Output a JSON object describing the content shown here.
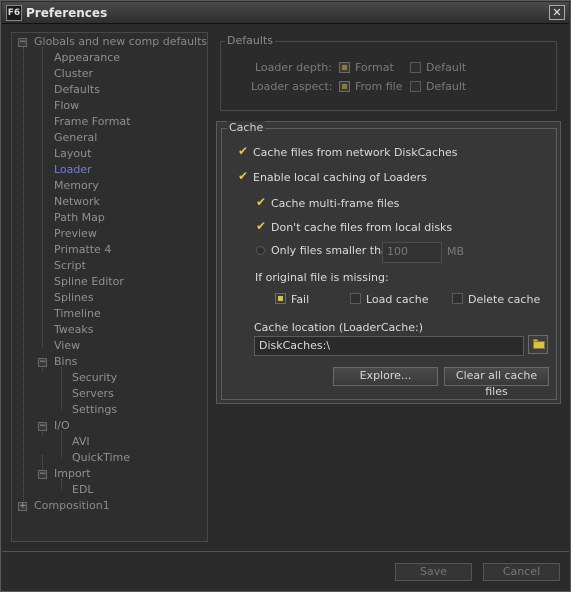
{
  "window": {
    "app_icon": "F6",
    "title": "Preferences",
    "close_glyph": "✕"
  },
  "tree": {
    "root": "Globals and new comp defaults",
    "items": [
      "Appearance",
      "Cluster",
      "Defaults",
      "Flow",
      "Frame Format",
      "General",
      "Layout",
      "Loader",
      "Memory",
      "Network",
      "Path Map",
      "Preview",
      "Primatte 4",
      "Script",
      "Spline Editor",
      "Splines",
      "Timeline",
      "Tweaks",
      "View"
    ],
    "selected": "Loader",
    "bins": {
      "label": "Bins",
      "children": [
        "Security",
        "Servers",
        "Settings"
      ]
    },
    "io": {
      "label": "I/O",
      "children": [
        "AVI",
        "QuickTime"
      ]
    },
    "import": {
      "label": "Import",
      "children": [
        "EDL"
      ]
    },
    "composition": "Composition1",
    "expander_minus": "−",
    "expander_plus": "+"
  },
  "defaults": {
    "title": "Defaults",
    "loader_depth_label": "Loader depth:",
    "loader_aspect_label": "Loader aspect:",
    "format_label": "Format",
    "from_file_label": "From file",
    "default_label": "Default"
  },
  "cache": {
    "title": "Cache",
    "network_cache_label": "Cache files from network DiskCaches",
    "local_cache_label": "Enable local caching of Loaders",
    "multi_frame_label": "Cache multi-frame files",
    "no_local_disks_label": "Don't cache files from local disks",
    "smaller_than_label": "Only files smaller than",
    "smaller_than_value": "100",
    "mb_label": "MB",
    "missing_label": "If original file is missing:",
    "fail_label": "Fail",
    "load_cache_label": "Load cache",
    "delete_cache_label": "Delete cache",
    "location_label": "Cache location (LoaderCache:)",
    "location_value": "DiskCaches:\\",
    "explore_label": "Explore...",
    "clear_label": "Clear all cache files",
    "check_glyph": "✔"
  },
  "footer": {
    "save_label": "Save",
    "cancel_label": "Cancel"
  },
  "colors": {
    "accent": "#d9c248",
    "selection": "#6f7fd8",
    "background": "#2b2b2b"
  },
  "icons": {
    "folder": "folder-icon",
    "close": "close-icon",
    "app": "app-icon"
  }
}
